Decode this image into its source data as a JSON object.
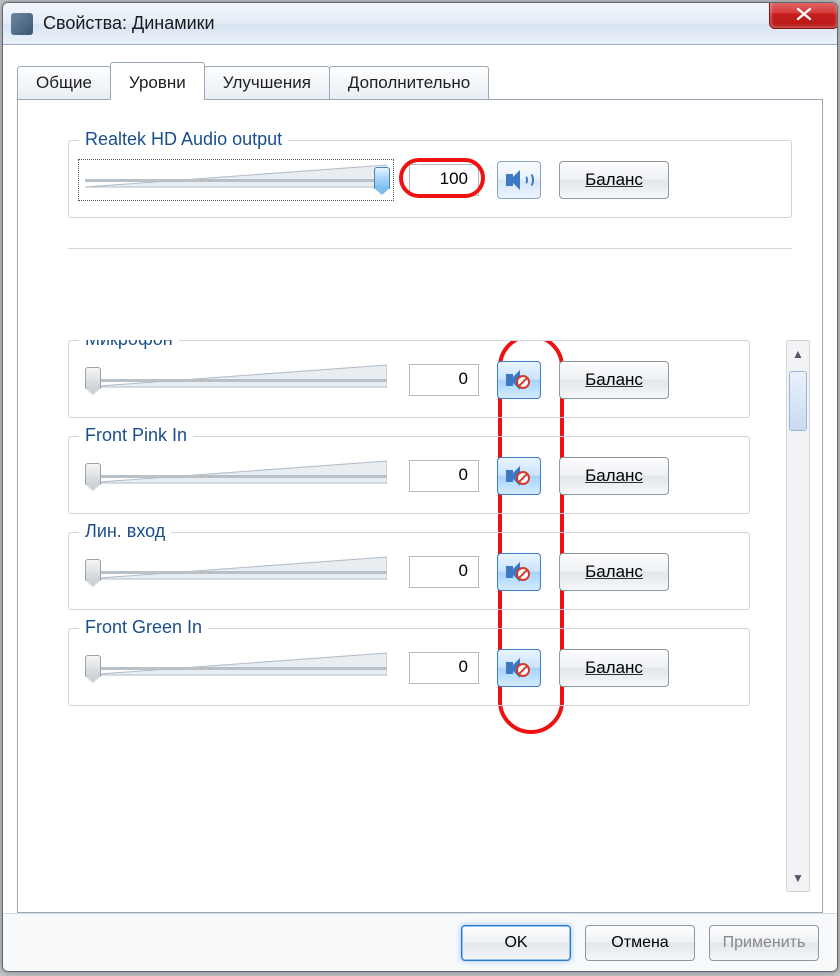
{
  "window": {
    "title": "Свойства: Динамики"
  },
  "tabs": {
    "general": "Общие",
    "levels": "Уровни",
    "enhance": "Улучшения",
    "advanced": "Дополнительно"
  },
  "buttons": {
    "balance": "Баланс",
    "ok": "OK",
    "cancel": "Отмена",
    "apply": "Применить"
  },
  "main": {
    "label": "Realtek HD Audio output",
    "value": "100",
    "slider_percent": 100,
    "muted": false
  },
  "channels": [
    {
      "label": "Микрофон",
      "value": "0",
      "slider_percent": 0,
      "muted": true
    },
    {
      "label": "Front Pink In",
      "value": "0",
      "slider_percent": 0,
      "muted": true
    },
    {
      "label": "Лин. вход",
      "value": "0",
      "slider_percent": 0,
      "muted": true
    },
    {
      "label": "Front Green In",
      "value": "0",
      "slider_percent": 0,
      "muted": true
    }
  ]
}
